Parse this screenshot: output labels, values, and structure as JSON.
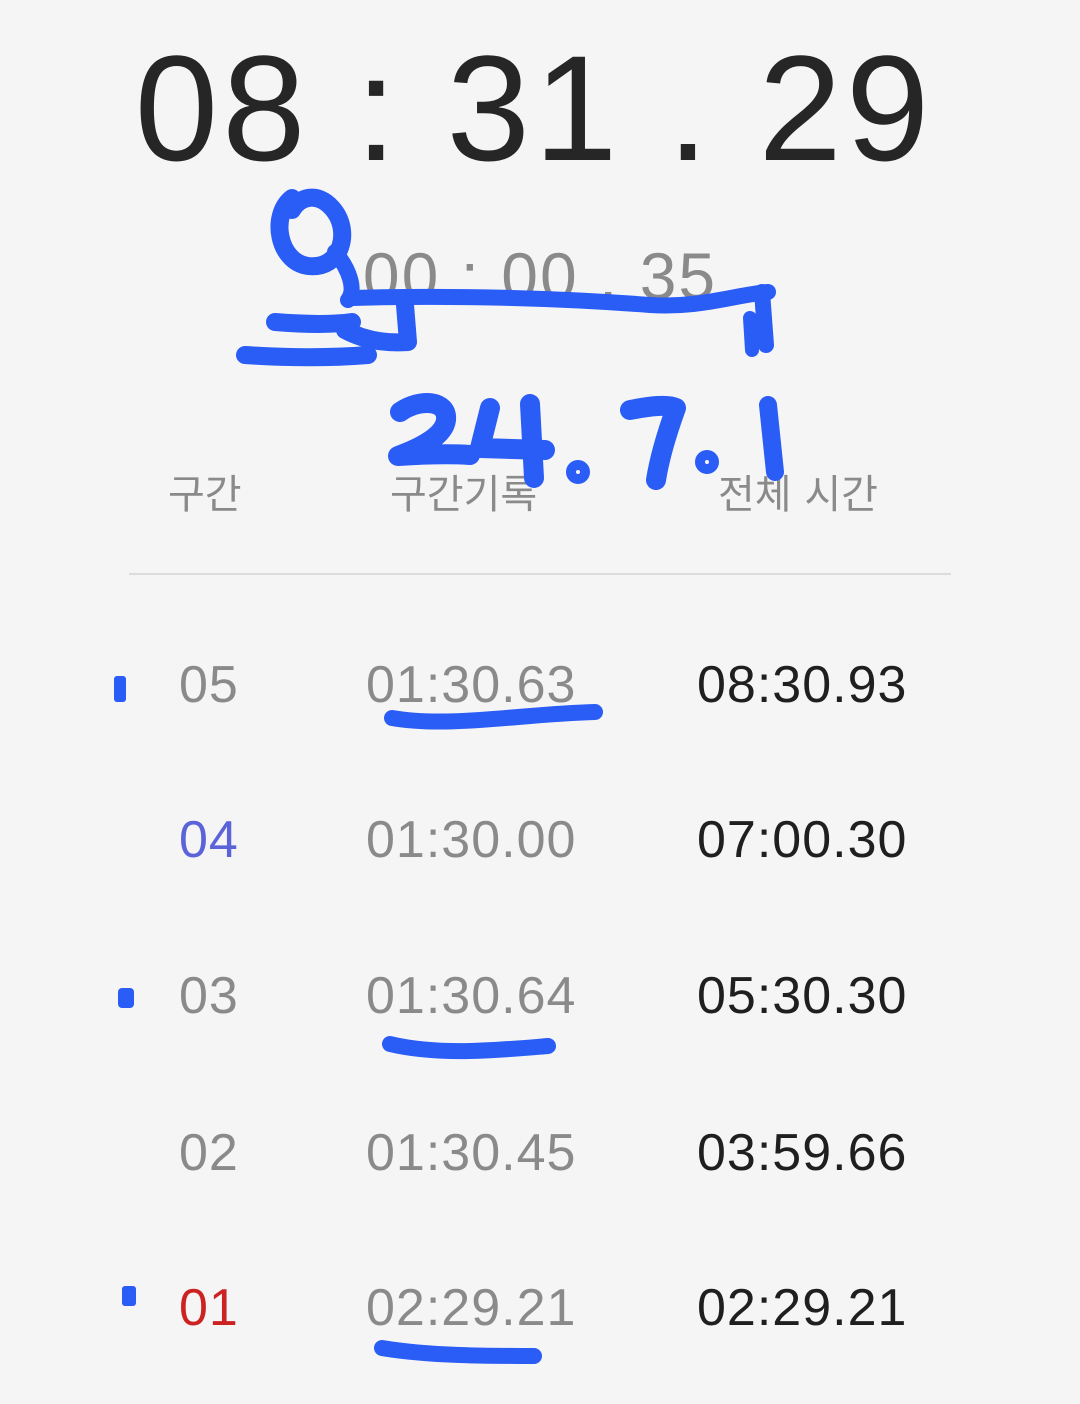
{
  "stopwatch": {
    "main_time": "08 : 31 . 29",
    "lap_time": "00 : 00 . 35"
  },
  "table": {
    "headers": [
      "구간",
      "구간기록",
      "전체 시간"
    ],
    "rows": [
      {
        "lap": "05",
        "split": "01:30.63",
        "total": "08:30.93",
        "lap_color": "#8a8a8a"
      },
      {
        "lap": "04",
        "split": "01:30.00",
        "total": "07:00.30",
        "lap_color": "#5b63d8"
      },
      {
        "lap": "03",
        "split": "01:30.64",
        "total": "05:30.30",
        "lap_color": "#8a8a8a"
      },
      {
        "lap": "02",
        "split": "01:30.45",
        "total": "03:59.66",
        "lap_color": "#8a8a8a"
      },
      {
        "lap": "01",
        "split": "02:29.21",
        "total": "02:29.21",
        "lap_color": "#cc2222"
      }
    ]
  },
  "annotations": {
    "handwritten_date": "24.7.1",
    "ink_color": "#2a5cf6"
  }
}
